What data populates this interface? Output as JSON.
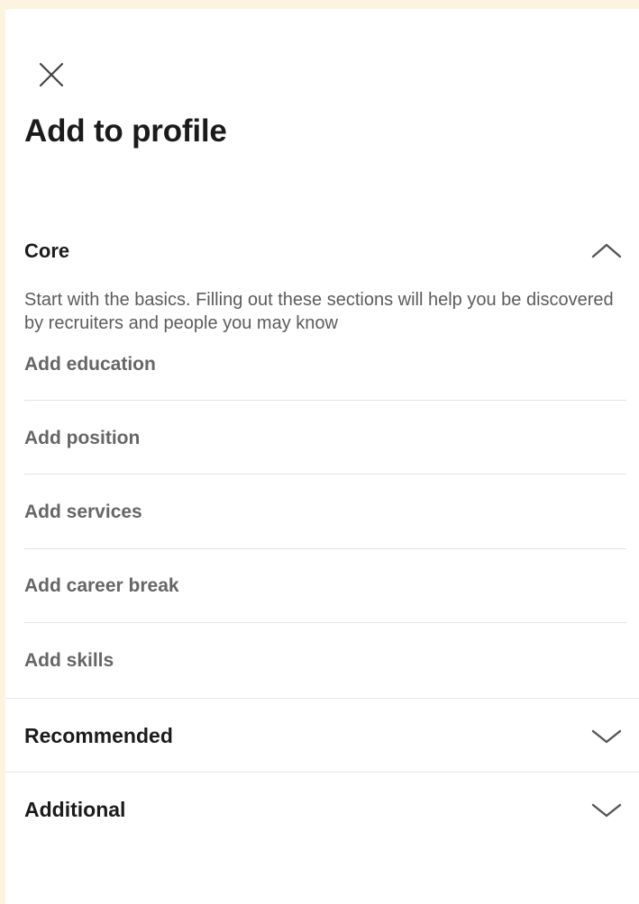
{
  "header": {
    "close_icon": "close-icon",
    "title": "Add to profile"
  },
  "sections": {
    "core": {
      "title": "Core",
      "expanded": true,
      "chevron_icon": "chevron-up-icon",
      "description": "Start with the basics. Filling out these sections will help you be discovered by recruiters and people you may know",
      "items": [
        {
          "label": "Add education"
        },
        {
          "label": "Add position"
        },
        {
          "label": "Add services"
        },
        {
          "label": "Add career break"
        },
        {
          "label": "Add skills"
        }
      ]
    },
    "recommended": {
      "title": "Recommended",
      "expanded": false,
      "chevron_icon": "chevron-down-icon"
    },
    "additional": {
      "title": "Additional",
      "expanded": false,
      "chevron_icon": "chevron-down-icon"
    }
  },
  "colors": {
    "page_background": "#fdf3e1",
    "sheet_background": "#ffffff",
    "title_text": "#1b1b1b",
    "item_text": "#666666",
    "divider": "#e3e3e3"
  }
}
